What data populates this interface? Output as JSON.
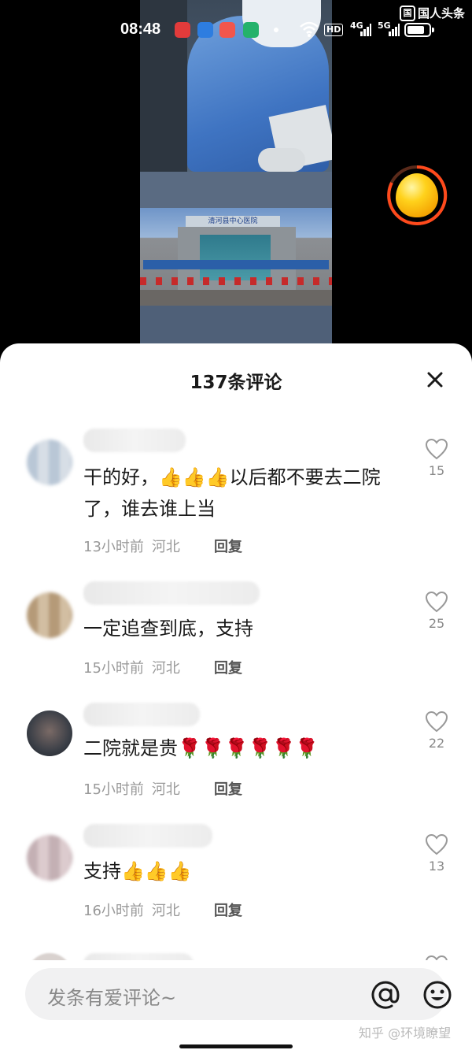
{
  "status_bar": {
    "time": "08:48",
    "network_hd": "HD",
    "network_4g": "4G",
    "network_5g": "5G",
    "battery_level": 0.8
  },
  "watermark_top": {
    "logo": "国",
    "text": "国人头条"
  },
  "video": {
    "hospital_sign": "清河县中心医院"
  },
  "comments_panel": {
    "title": "137条评论",
    "close_icon": "close-icon"
  },
  "comments": [
    {
      "text": "干的好，👍👍👍以后都不要去二院了，谁去谁上当",
      "time": "13小时前",
      "location": "河北",
      "reply_label": "回复",
      "likes": "15"
    },
    {
      "text": "一定追查到底，支持",
      "time": "15小时前",
      "location": "河北",
      "reply_label": "回复",
      "likes": "25"
    },
    {
      "text": "二院就是贵🌹🌹🌹🌹🌹🌹",
      "time": "15小时前",
      "location": "河北",
      "reply_label": "回复",
      "likes": "22"
    },
    {
      "text": "支持👍👍👍",
      "time": "16小时前",
      "location": "河北",
      "reply_label": "回复",
      "likes": "13"
    }
  ],
  "input_bar": {
    "placeholder": "发条有爱评论~",
    "at_icon": "at-icon",
    "emoji_icon": "emoji-icon"
  },
  "watermark_bottom": "知乎 @环境瞭望",
  "colors": {
    "sheet_bg": "#ffffff",
    "text_primary": "#1a1a1a",
    "text_meta": "#999999",
    "input_bg": "#f1f1f2"
  }
}
